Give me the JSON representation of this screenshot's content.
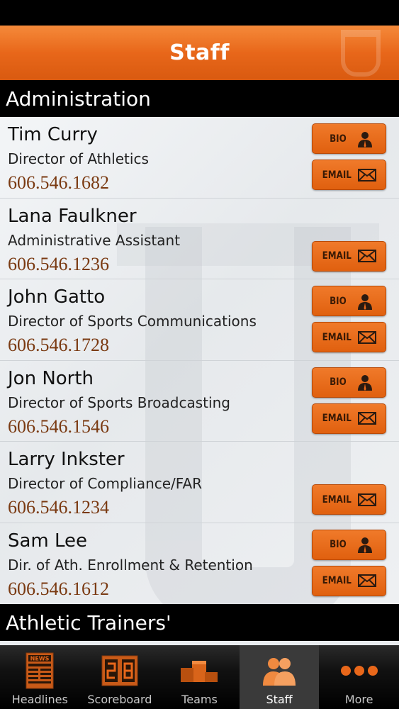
{
  "nav": {
    "title": "Staff"
  },
  "sections": [
    {
      "title": "Administration"
    },
    {
      "title": "Athletic Trainers'"
    }
  ],
  "buttons": {
    "bio": "BIO",
    "email": "EMAIL"
  },
  "staff": [
    {
      "name": "Tim Curry",
      "title": "Director of Athletics",
      "phone": "606.546.1682",
      "has_bio": true
    },
    {
      "name": "Lana Faulkner",
      "title": "Administrative Assistant",
      "phone": "606.546.1236",
      "has_bio": false
    },
    {
      "name": "John Gatto",
      "title": "Director of Sports Communications",
      "phone": "606.546.1728",
      "has_bio": true
    },
    {
      "name": "Jon North",
      "title": "Director of Sports Broadcasting",
      "phone": "606.546.1546",
      "has_bio": true
    },
    {
      "name": "Larry Inkster",
      "title": "Director of Compliance/FAR",
      "phone": "606.546.1234",
      "has_bio": false
    },
    {
      "name": "Sam Lee",
      "title": "Dir. of Ath. Enrollment & Retention",
      "phone": "606.546.1612",
      "has_bio": true
    }
  ],
  "tabs": [
    {
      "label": "Headlines",
      "icon": "newspaper-icon"
    },
    {
      "label": "Scoreboard",
      "icon": "scoreboard-icon"
    },
    {
      "label": "Teams",
      "icon": "podium-icon"
    },
    {
      "label": "Staff",
      "icon": "people-icon",
      "active": true
    },
    {
      "label": "More",
      "icon": "more-dots-icon"
    }
  ],
  "colors": {
    "accent": "#e8671a",
    "header": "#000000",
    "phone": "#7a3a12"
  }
}
